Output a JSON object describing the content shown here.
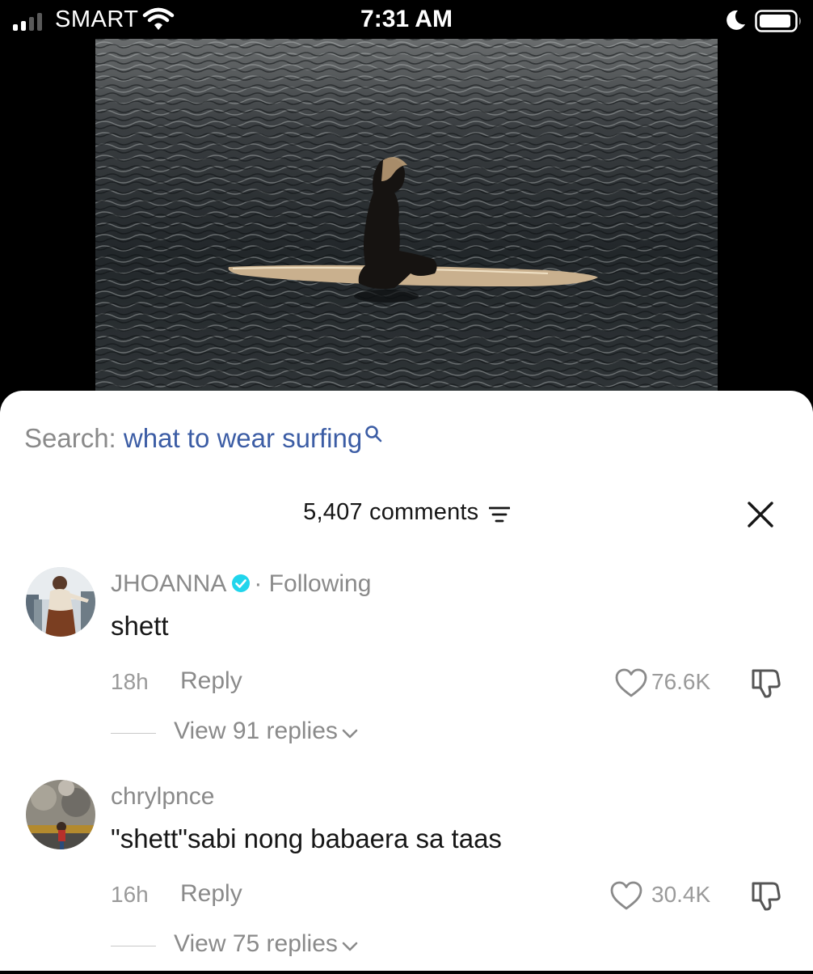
{
  "status_bar": {
    "carrier": "SMART",
    "time": "7:31 AM"
  },
  "search": {
    "prefix": "Search: ",
    "query": "what to wear surfing"
  },
  "comments_header": {
    "count_label": "5,407 comments"
  },
  "comments": [
    {
      "username": "JHOANNA",
      "verified": true,
      "following_label": "· Following",
      "text": "shett",
      "time": "18h",
      "reply_label": "Reply",
      "likes": "76.6K",
      "view_replies_label": "View 91 replies"
    },
    {
      "username": "chrylpnce",
      "verified": false,
      "following_label": "",
      "text": "\"shett\"sabi nong babaera sa taas",
      "time": "16h",
      "reply_label": "Reply",
      "likes": "30.4K",
      "view_replies_label": "View 75 replies"
    }
  ],
  "colors": {
    "search_query": "#3c5da5",
    "verified_badge": "#20d5ec",
    "muted_text": "#8a8a8a"
  },
  "icons": [
    "signal-icon",
    "wifi-icon",
    "moon-icon",
    "battery-icon",
    "search-icon",
    "filter-icon",
    "close-icon",
    "verified-icon",
    "heart-icon",
    "dislike-icon",
    "chevron-down-icon"
  ]
}
